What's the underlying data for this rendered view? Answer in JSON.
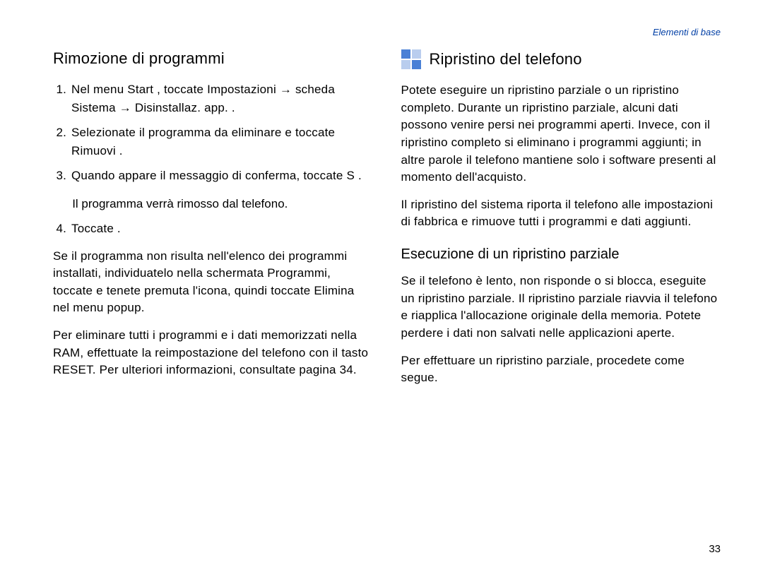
{
  "headerRight": "Elementi di base",
  "pageNumber": "33",
  "left": {
    "heading": "Rimozione di programmi",
    "steps": [
      "Nel menu Start , toccate Impostazioni → scheda Sistema   → Disinstallaz. app.        .",
      "Selezionate il programma da eliminare e toccate Rimuovi  .",
      "Quando appare il messaggio di conferma, toccate S ."
    ],
    "afterStep3": "Il programma verrà rimosso dal telefono.",
    "step4": "Toccate        .",
    "para1": "Se il programma non risulta nell'elenco dei programmi installati, individuatelo nella schermata Programmi, toccate e tenete premuta l'icona, quindi toccate Elimina   nel menu popup.",
    "para2": "Per eliminare tutti i programmi e i dati memorizzati nella RAM, effettuate la reimpostazione del telefono con il tasto RESET. Per ulteriori informazioni, consultate pagina 34."
  },
  "right": {
    "heading": "Ripristino del telefono",
    "para1": "Potete eseguire un ripristino parziale o un ripristino completo. Durante un ripristino parziale, alcuni dati possono venire persi nei programmi aperti. Invece, con il ripristino completo si eliminano i programmi aggiunti; in altre parole il telefono mantiene solo i software presenti al momento dell'acquisto.",
    "para2": "Il ripristino del sistema riporta il telefono alle impostazioni di fabbrica e rimuove tutti i programmi e dati aggiunti.",
    "subheading": "Esecuzione di un ripristino parziale",
    "para3": "Se il telefono è lento, non risponde o si blocca, eseguite un ripristino parziale. Il ripristino parziale riavvia il telefono e riapplica l'allocazione originale della memoria. Potete perdere i dati non salvati nelle applicazioni aperte.",
    "para4": "Per effettuare un ripristino parziale, procedete come segue."
  }
}
